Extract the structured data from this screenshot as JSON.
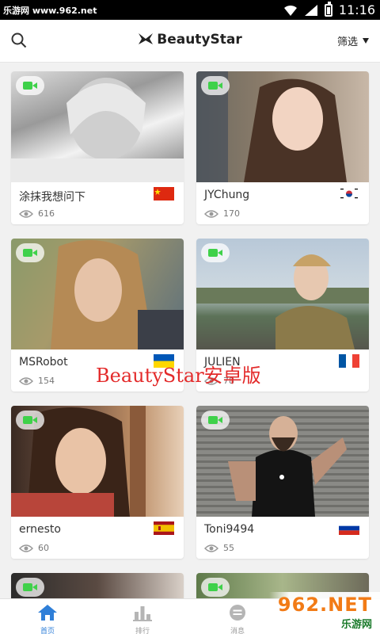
{
  "status_bar": {
    "watermark": "乐游网 www.962.net",
    "time": "11:16"
  },
  "header": {
    "brand": "BeautyStar",
    "filter_label": "筛选"
  },
  "cards": [
    {
      "name": "涂抹我想问下",
      "views": "616",
      "flag": "china"
    },
    {
      "name": "JYChung",
      "views": "170",
      "flag": "south-korea"
    },
    {
      "name": "MSRobot",
      "views": "154",
      "flag": "ukraine"
    },
    {
      "name": "JULIEN",
      "views": "78",
      "flag": "france"
    },
    {
      "name": "ernesto",
      "views": "60",
      "flag": "spain"
    },
    {
      "name": "Toni9494",
      "views": "55",
      "flag": "russia"
    }
  ],
  "overlay_text": "BeautyStar安卓版",
  "bottom_nav": [
    {
      "label": "首页",
      "icon": "home-icon",
      "active": true
    },
    {
      "label": "排行",
      "icon": "ranking-icon",
      "active": false
    },
    {
      "label": "消息",
      "icon": "message-icon",
      "active": false
    }
  ],
  "site_logo": {
    "line1": "962.NET",
    "line2": "乐游网"
  },
  "colors": {
    "accent": "#2f7fd8",
    "video_badge": "#3fd14a",
    "watermark_red": "#e32a2a"
  }
}
